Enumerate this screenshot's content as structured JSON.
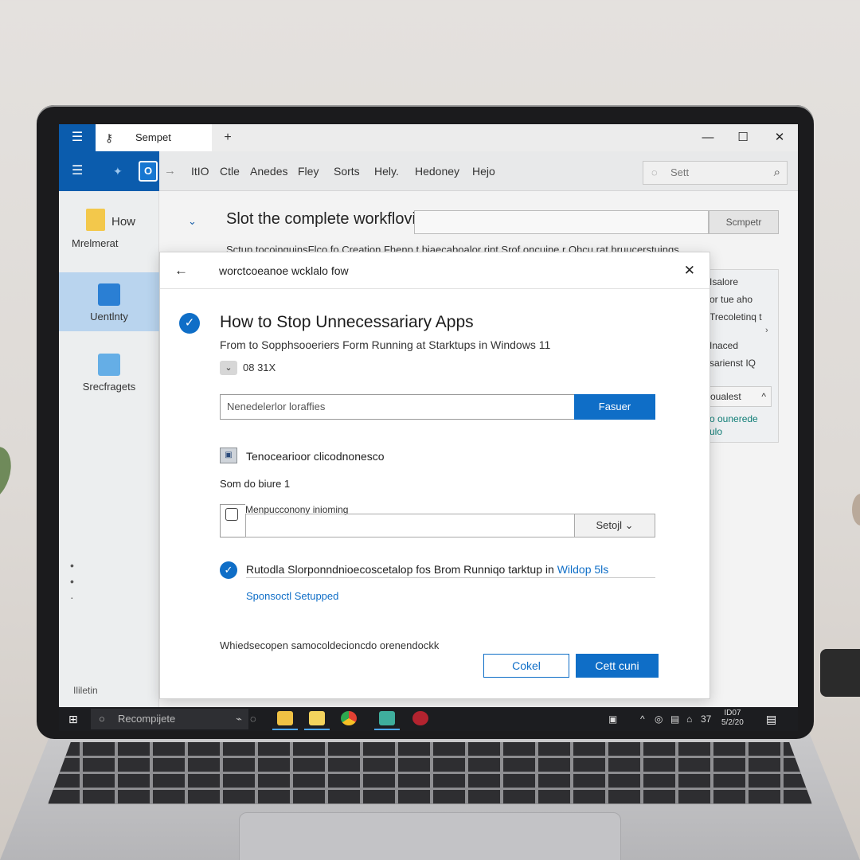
{
  "browser": {
    "tab_label": "Sempet",
    "tab_icon": "key-icon",
    "new_tab": "+",
    "minimize": "—",
    "maximize": "☐",
    "close": "✕"
  },
  "toolbar": {
    "logo_letter": "O",
    "menu_items": [
      "ItIO",
      "Ctle",
      "Anedes",
      "Fley",
      "Sorts",
      "Hely.",
      "Hedoney",
      "Hejo"
    ],
    "search_placeholder": "Sett"
  },
  "sidebar": {
    "items": [
      {
        "title": "How",
        "subtitle": "Mrelmerat"
      },
      {
        "label": "Uentlnty",
        "active": true
      },
      {
        "label": "Srecfragets"
      }
    ],
    "footer": "Ililetin"
  },
  "main": {
    "heading": "Slot the complete workflovic",
    "button": "Scmpetr",
    "description": "Sctup tocoinguinsFlco fo Creation Fhenp t biaecaboalor rint Srof oncuine r Ohcu rat bruucerstuings."
  },
  "right_panel": {
    "lines": [
      "Isalore",
      "or tue aho",
      "Trecoletinq t",
      "Inaced",
      "sarienst IQ"
    ],
    "button": "oualest",
    "link_lines": [
      "o ounerede",
      "ulo"
    ]
  },
  "dialog": {
    "breadcrumb": "worctcoeanoe wcklalo fow",
    "title": "How to Stop Unnecessariary Apps",
    "subtitle": "From to Sopphsooeriers Form Running at Starktups in Windows 11",
    "version": "08 31X",
    "input_placeholder": "Nenedelerlor loraffies",
    "search_button": "Fasuer",
    "option_label": "Tenocearioor clicodnonesco",
    "section_label": "Som do biure 1",
    "select_label": "Menpucconony inioming",
    "select_value": "Setojl",
    "result_text": "Rutodla Slorponndnioecoscetalop fos Brom Runniqo tarktup in",
    "result_link_text": "Wildop 5ls",
    "result_sub_link": "Sponsoctl Setupped",
    "footer_text": "Whiedsecopen samocoldecioncdo orenendockk",
    "cancel_button": "Cokel",
    "continue_button": "Cett cuni"
  },
  "taskbar": {
    "search_text": "Recompijete",
    "tray_items": [
      "^",
      "◎",
      "▤",
      "⌂",
      "37"
    ],
    "clock_time": "ID07",
    "clock_date": "5/2/20"
  },
  "colors": {
    "accent": "#0f6ec7",
    "toolbar_blue": "#0b5cad",
    "taskbar": "#1c1d20"
  }
}
